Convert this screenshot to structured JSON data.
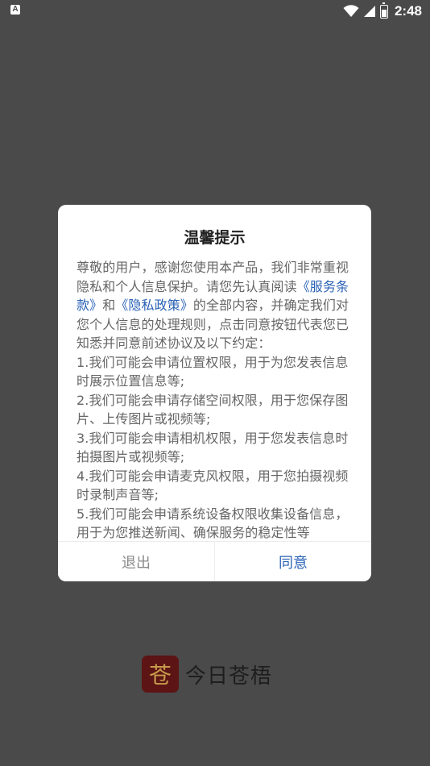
{
  "status_bar": {
    "left_icon": "A",
    "time": "2:48",
    "icons": [
      "wifi-icon",
      "signal-icon",
      "battery-icon"
    ]
  },
  "dialog": {
    "title": "温馨提示",
    "intro": {
      "part1": "尊敬的用户，感谢您使用本产品，我们非常重视隐私和个人信息保护。请您先认真阅读",
      "link_terms": "《服务条款》",
      "and": "和",
      "link_privacy": "《隐私政策》",
      "part2": "的全部内容，并确定我们对您个人信息的处理规则，点击同意按钮代表您已知悉并同意前述协议及以下约定："
    },
    "clauses": [
      "1.我们可能会申请位置权限，用于为您发表信息时展示位置信息等;",
      "2.我们可能会申请存储空间权限，用于您保存图片、上传图片或视频等;",
      "3.我们可能会申请相机权限，用于您发表信息时拍摄图片或视频等;",
      "4.我们可能会申请麦克风权限，用于您拍摄视频时录制声音等;",
      "5.我们可能会申请系统设备权限收集设备信息，用于为您推送新闻、确保服务的稳定性等"
    ],
    "buttons": {
      "exit": "退出",
      "agree": "同意"
    }
  },
  "brand": {
    "logo_char": "苍",
    "name": "今日苍梧"
  },
  "colors": {
    "background": "#4a4a4a",
    "link": "#2a62b5",
    "body_text": "#666666",
    "logo_bg": "#5c1414",
    "logo_char": "#c69a4c"
  }
}
